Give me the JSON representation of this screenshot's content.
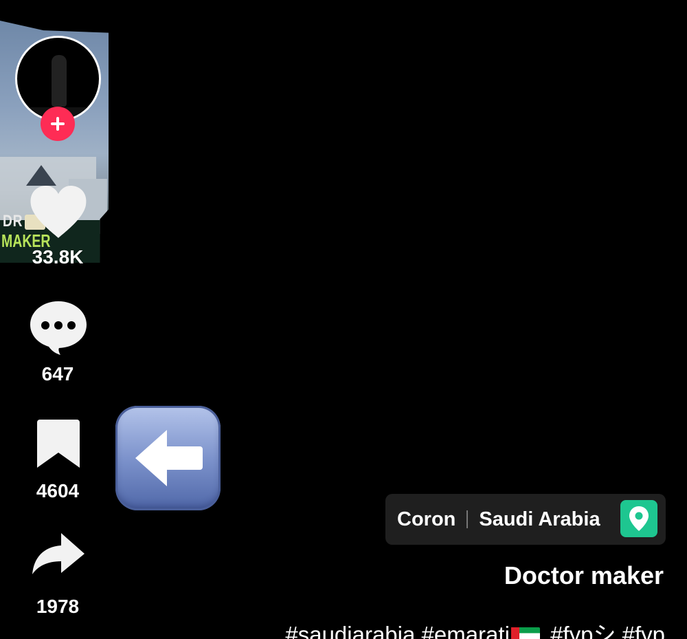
{
  "thumbnail": {
    "label_line1": "DR",
    "label_line2": "MAKER"
  },
  "actions": {
    "likes": "33.8K",
    "comments": "647",
    "bookmarks": "4604",
    "shares": "1978"
  },
  "location": {
    "city": "Coron",
    "country": "Saudi Arabia",
    "icon": "map-pin-icon",
    "color": "#1ec690"
  },
  "post": {
    "username": "Doctor maker",
    "caption_before_flag": "#saudiarabia #emarati",
    "caption_after_flag": " #fypシ #fyp"
  },
  "colors": {
    "follow": "#fe2c55",
    "background": "#000000"
  }
}
